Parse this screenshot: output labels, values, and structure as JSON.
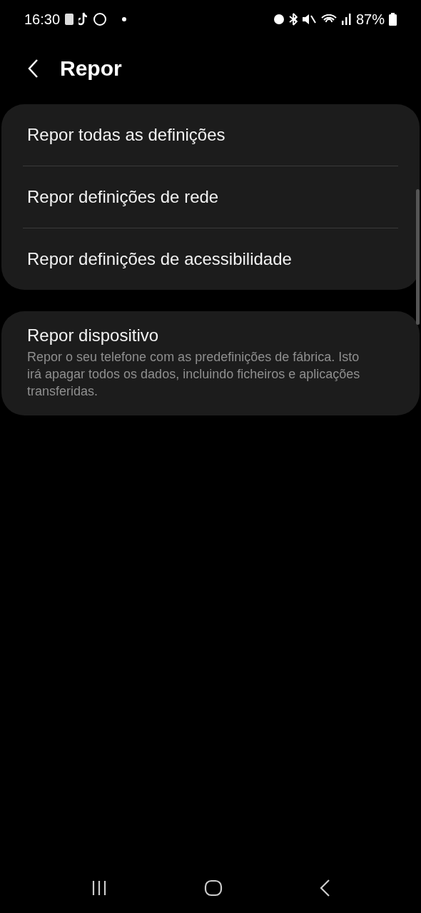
{
  "status_bar": {
    "time": "16:30",
    "battery": "87%"
  },
  "header": {
    "title": "Repor"
  },
  "groups": [
    {
      "items": [
        {
          "title": "Repor todas as definições"
        },
        {
          "title": "Repor definições de rede"
        },
        {
          "title": "Repor definições de acessibilidade"
        }
      ]
    },
    {
      "items": [
        {
          "title": "Repor dispositivo",
          "description": "Repor o seu telefone com as predefinições de fábrica. Isto irá apagar todos os dados, incluindo ficheiros e aplicações transferidas."
        }
      ]
    }
  ]
}
